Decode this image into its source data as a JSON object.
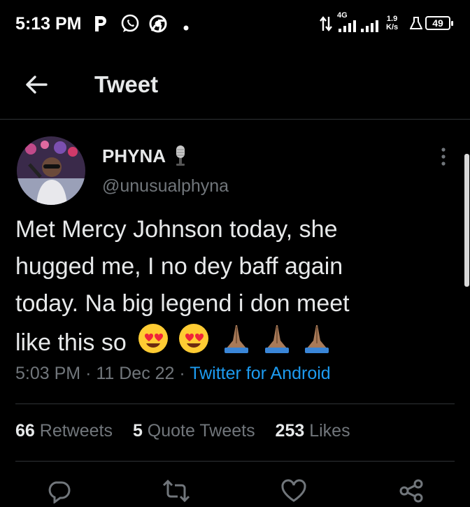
{
  "status_bar": {
    "time": "5:13 PM",
    "icons": [
      "p-app-icon",
      "whatsapp-icon",
      "chrome-icon",
      "dot-icon",
      "data-arrows-icon",
      "signal-4g-icon",
      "signal-icon"
    ],
    "network_type": "4G",
    "speed_value": "1.9",
    "speed_unit": "K/s",
    "battery": "49"
  },
  "header": {
    "back_icon": "arrow-left-icon",
    "title": "Tweet"
  },
  "tweet": {
    "author_name": "PHYNA",
    "author_badge_icon": "microphone-icon",
    "author_handle": "@unusualphyna",
    "text_line1": "Met Mercy Johnson today, she",
    "text_line2": "hugged me, I no dey baff again",
    "text_line3": "today. Na big legend i don meet",
    "text_line4": "like this so",
    "emojis": [
      "heart-eyes-emoji",
      "heart-eyes-emoji",
      "folded-hands-emoji",
      "folded-hands-emoji",
      "folded-hands-emoji"
    ],
    "time": "5:03 PM",
    "separator": "·",
    "date": "11 Dec 22",
    "source": "Twitter for Android"
  },
  "stats": {
    "retweets_count": "66",
    "retweets_label": "Retweets",
    "quotes_count": "5",
    "quotes_label": "Quote Tweets",
    "likes_count": "253",
    "likes_label": "Likes"
  },
  "actions": [
    "reply-icon",
    "retweet-icon",
    "like-icon",
    "share-icon"
  ],
  "colors": {
    "background": "#000000",
    "text": "#e7e9ea",
    "secondary": "#71767b",
    "link": "#1d9bf0",
    "divider": "#2f3336"
  }
}
